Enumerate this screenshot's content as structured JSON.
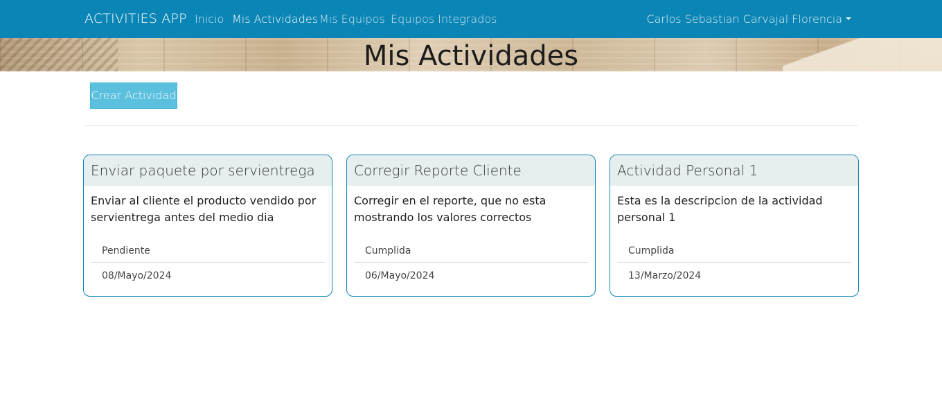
{
  "navbar": {
    "brand": "ACTIVITIES APP",
    "links": [
      "Inicio",
      "Mis Actividades",
      "Mis Equipos",
      "Equipos Integrados"
    ],
    "active_link": "Mis Actividades",
    "user": "Carlos Sebastian Carvajal Florencia"
  },
  "banner": {
    "title": "Mis Actividades"
  },
  "actions": {
    "create_label": "Crear Actividad"
  },
  "activities": [
    {
      "title": "Enviar paquete por servientrega",
      "description": "Enviar al cliente el producto vendido por servientrega antes del medio dia",
      "status": "Pendiente",
      "date": "08/Mayo/2024"
    },
    {
      "title": "Corregir Reporte Cliente",
      "description": "Corregir en el reporte, que no esta mostrando los valores correctos",
      "status": "Cumplida",
      "date": "06/Mayo/2024"
    },
    {
      "title": "Actividad Personal 1",
      "description": "Esta es la descripcion de la actividad personal 1",
      "status": "Cumplida",
      "date": "13/Marzo/2024"
    }
  ],
  "colors": {
    "navbar": "#0a85b5",
    "button": "#5bc0de",
    "card_border": "#0a85b5",
    "card_header": "#e6eef0"
  }
}
